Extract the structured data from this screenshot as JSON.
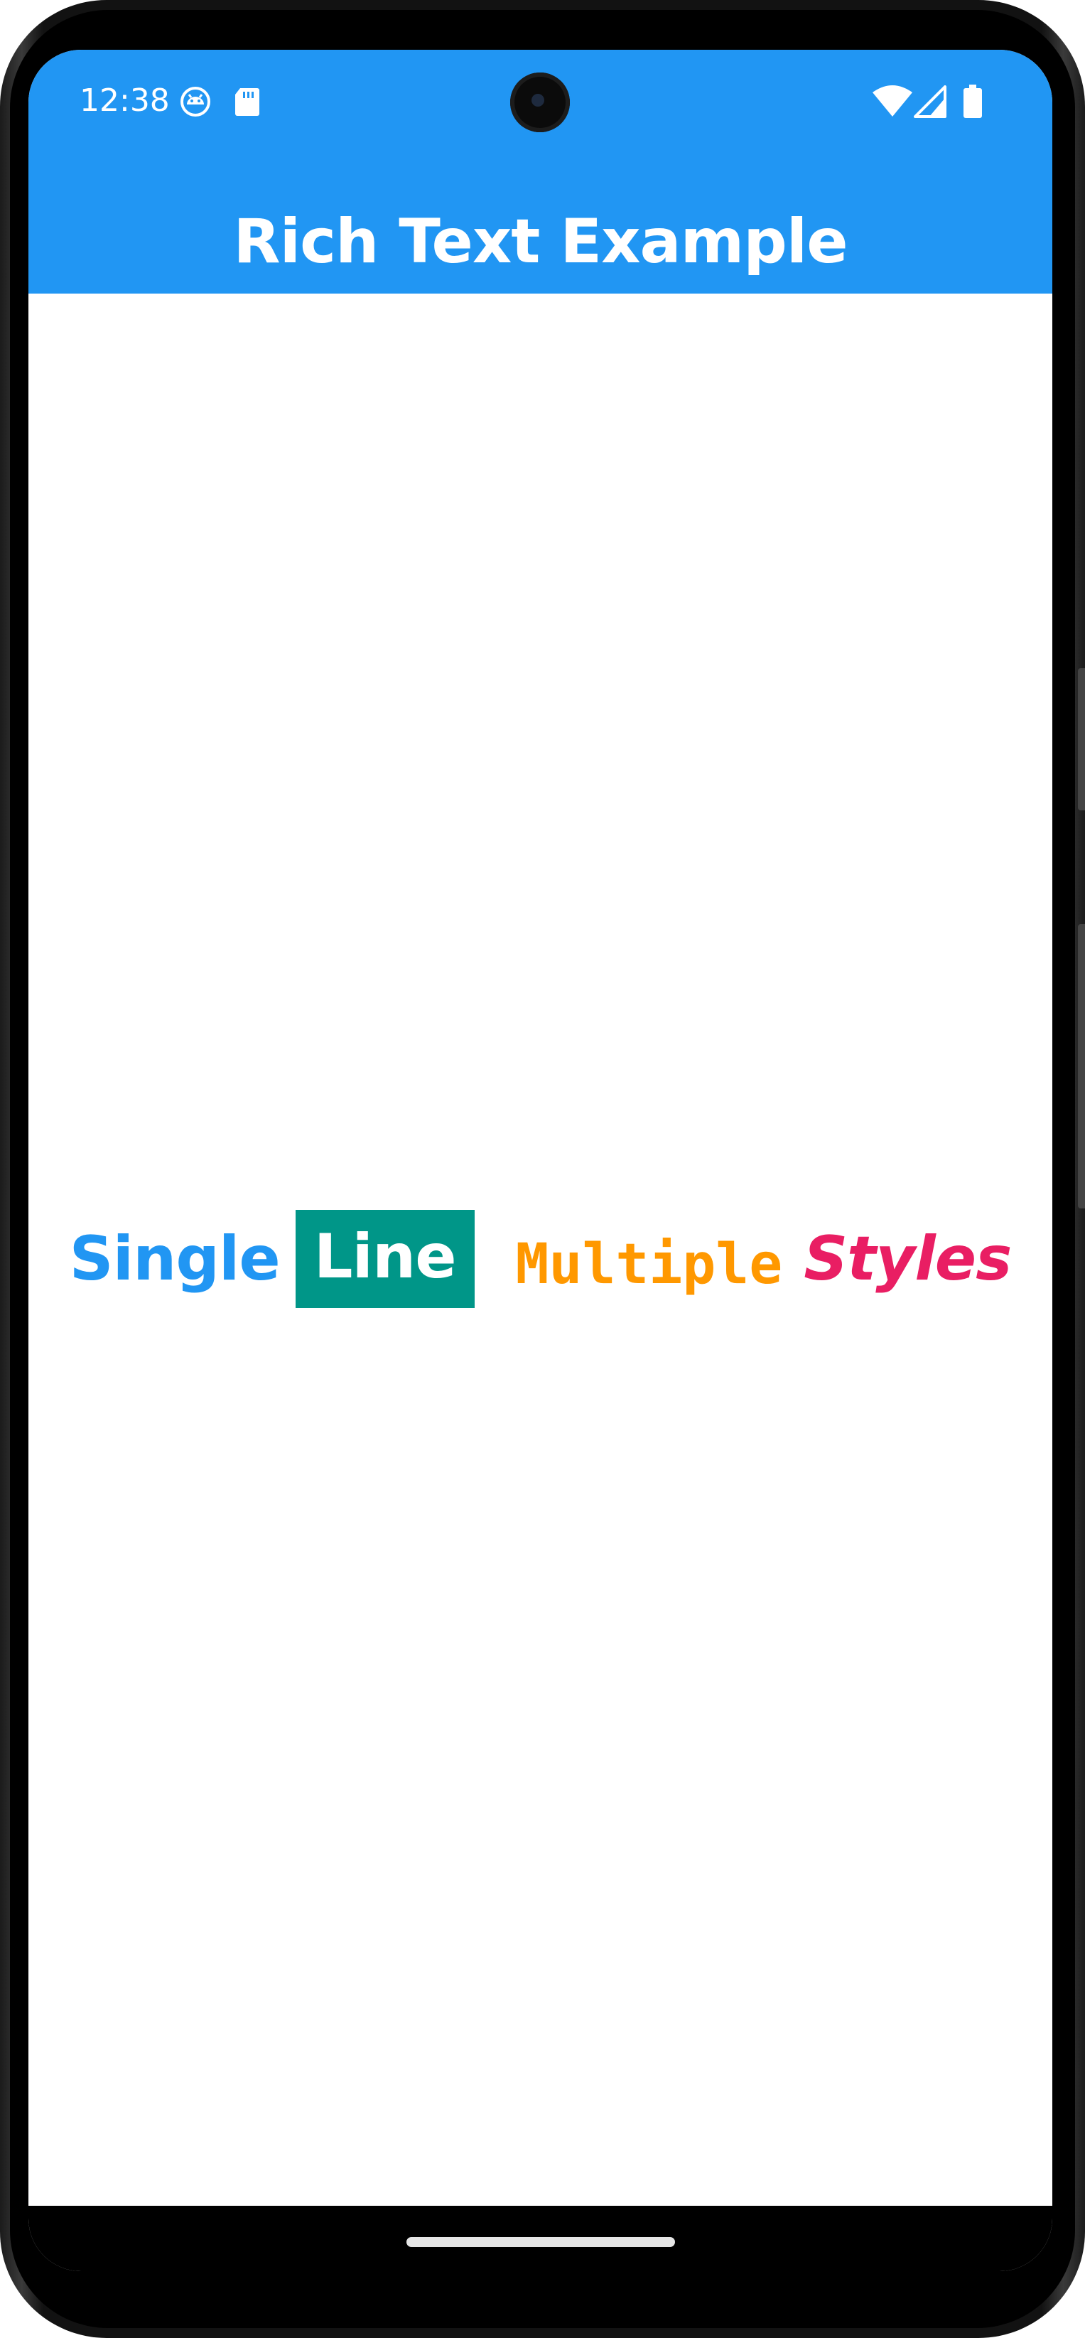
{
  "status_bar": {
    "time": "12:38",
    "left_icons": [
      "android-debug-icon",
      "sd-card-icon"
    ],
    "right_icons": [
      "wifi-icon",
      "cellular-signal-icon",
      "battery-icon"
    ]
  },
  "app_bar": {
    "title": "Rich Text Example",
    "background_color": "#2196f3"
  },
  "rich_text": {
    "segments": [
      {
        "text": "Single",
        "color": "#2196f3",
        "style": "bold"
      },
      {
        "text": "Line",
        "color": "#ffffff",
        "background": "#009688",
        "style": "bold"
      },
      {
        "text": "Multiple",
        "color": "#ff9800",
        "style": "bold monospace"
      },
      {
        "text": "Styles",
        "color": "#e91e63",
        "style": "bold italic"
      }
    ]
  },
  "navigation": {
    "gesture_handle": "home-indicator"
  }
}
